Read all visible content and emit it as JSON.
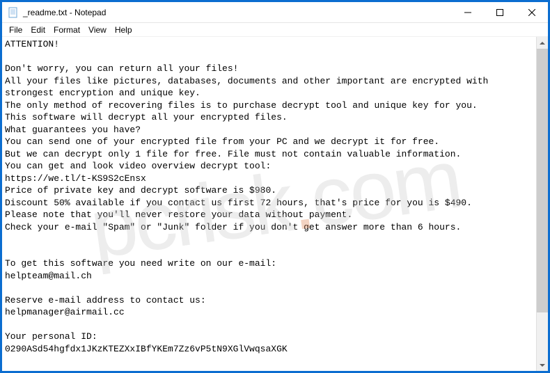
{
  "titlebar": {
    "title": "_readme.txt - Notepad"
  },
  "menubar": {
    "file": "File",
    "edit": "Edit",
    "format": "Format",
    "view": "View",
    "help": "Help"
  },
  "content": {
    "text": "ATTENTION!\n\nDon't worry, you can return all your files!\nAll your files like pictures, databases, documents and other important are encrypted with strongest encryption and unique key.\nThe only method of recovering files is to purchase decrypt tool and unique key for you.\nThis software will decrypt all your encrypted files.\nWhat guarantees you have?\nYou can send one of your encrypted file from your PC and we decrypt it for free.\nBut we can decrypt only 1 file for free. File must not contain valuable information.\nYou can get and look video overview decrypt tool:\nhttps://we.tl/t-KS9S2cEnsx\nPrice of private key and decrypt software is $980.\nDiscount 50% available if you contact us first 72 hours, that's price for you is $490.\nPlease note that you'll never restore your data without payment.\nCheck your e-mail \"Spam\" or \"Junk\" folder if you don't get answer more than 6 hours.\n\n\nTo get this software you need write on our e-mail:\nhelpteam@mail.ch\n\nReserve e-mail address to contact us:\nhelpmanager@airmail.cc\n\nYour personal ID:\n0290ASd54hgfdx1JKzKTEZXxIBfYKEm7Zz6vP5tN9XGlVwqsaXGK"
  },
  "watermark": {
    "text_left": "pcrisk",
    "dot": ".",
    "text_right": "com"
  }
}
